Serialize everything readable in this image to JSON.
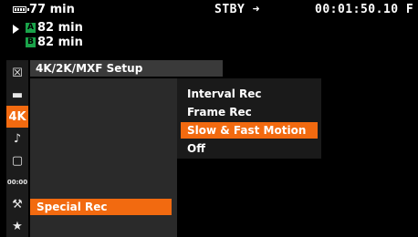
{
  "status": {
    "battery_time": "77 min",
    "media_a_label": "A",
    "media_a_time": "82 min",
    "media_b_label": "B",
    "media_b_time": "82 min",
    "record_status": "STBY ➜",
    "timecode": "00:01:50.10 F"
  },
  "sidebar": {
    "icons": [
      {
        "name": "close-icon",
        "glyph": "☒",
        "active": false
      },
      {
        "name": "camera-icon",
        "glyph": "▬",
        "active": false
      },
      {
        "name": "4k-icon",
        "glyph": "4K",
        "active": true
      },
      {
        "name": "audio-icon",
        "glyph": "♪",
        "active": false
      },
      {
        "name": "display-icon",
        "glyph": "▢",
        "active": false
      },
      {
        "name": "timecode-icon",
        "glyph": "00:00",
        "active": false
      },
      {
        "name": "wrench-icon",
        "glyph": "⚒",
        "active": false
      },
      {
        "name": "star-icon",
        "glyph": "★",
        "active": false
      }
    ]
  },
  "menu": {
    "title": "4K/2K/MXF Setup",
    "left_item": "Special Rec",
    "options": [
      "Interval Rec",
      "Frame Rec",
      "Slow & Fast Motion",
      "Off"
    ],
    "selected_option": "Slow & Fast Motion"
  },
  "colors": {
    "accent": "#f26a10",
    "media_badge": "#1aa34a"
  }
}
